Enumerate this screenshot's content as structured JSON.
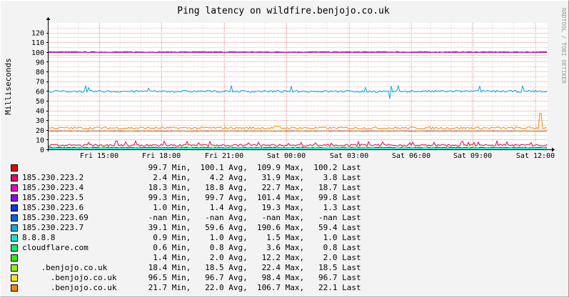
{
  "title": "Ping latency on wildfire.benjojo.co.uk",
  "watermark": "RRDTOOL / TOBI OETIKER",
  "chart_data": {
    "type": "line",
    "title": "Ping latency on wildfire.benjojo.co.uk",
    "ylabel": "Milliseconds",
    "xlabel": "",
    "ylim": [
      0,
      130
    ],
    "yticks": [
      "0",
      "10",
      "20",
      "30",
      "40",
      "50",
      "60",
      "70",
      "80",
      "90",
      "100",
      "110",
      "120"
    ],
    "xticks": [
      "Fri 15:00",
      "Fri 18:00",
      "Fri 21:00",
      "Sat 00:00",
      "Sat 03:00",
      "Sat 06:00",
      "Sat 09:00",
      "Sat 12:00"
    ],
    "grid": true,
    "series": [
      {
        "name": "",
        "color": "#ee0000",
        "min": "99.7",
        "avg": "100.1",
        "max": "109.9",
        "last": "100.2",
        "base": 100.1
      },
      {
        "name": "185.230.223.2",
        "color": "#ee0066",
        "min": "2.4",
        "avg": "4.2",
        "max": "31.9",
        "last": "3.8",
        "base": 4.2
      },
      {
        "name": "185.230.223.4",
        "color": "#ee00cc",
        "min": "18.3",
        "avg": "18.8",
        "max": "22.7",
        "last": "18.7",
        "base": 18.8
      },
      {
        "name": "185.230.223.5",
        "color": "#9900ee",
        "min": "99.3",
        "avg": "99.7",
        "max": "101.4",
        "last": "99.8",
        "base": 99.7
      },
      {
        "name": "185.230.223.6",
        "color": "#1133ee",
        "min": "1.0",
        "avg": "1.4",
        "max": "19.3",
        "last": "1.3",
        "base": 1.4
      },
      {
        "name": "185.230.223.69",
        "color": "#0066ee",
        "min": "-nan",
        "avg": "-nan",
        "max": "-nan",
        "last": "-nan",
        "base": null
      },
      {
        "name": "185.230.223.7",
        "color": "#00aaee",
        "min": "39.1",
        "avg": "59.6",
        "max": "190.6",
        "last": "59.4",
        "base": 59.6
      },
      {
        "name": "8.8.8.8",
        "color": "#00eecc",
        "min": "0.9",
        "avg": "1.0",
        "max": "1.5",
        "last": "1.0",
        "base": 1.0
      },
      {
        "name": "cloudflare.com",
        "color": "#00ee66",
        "min": "0.6",
        "avg": "0.8",
        "max": "3.6",
        "last": "0.8",
        "base": 0.8
      },
      {
        "name": "",
        "color": "#33ee00",
        "min": "1.4",
        "avg": "2.0",
        "max": "12.2",
        "last": "2.0",
        "base": 2.0
      },
      {
        "name": ".benjojo.co.uk",
        "color": "#99ee00",
        "min": "18.4",
        "avg": "18.5",
        "max": "22.4",
        "last": "18.5",
        "base": 18.5
      },
      {
        "name": ".benjojo.co.uk",
        "color": "#eeee00",
        "min": "96.5",
        "avg": "96.7",
        "max": "98.4",
        "last": "96.7",
        "base": 96.7
      },
      {
        "name": ".benjojo.co.uk",
        "color": "#ee8800",
        "min": "21.7",
        "avg": "22.0",
        "max": "106.7",
        "last": "22.1",
        "base": 22.0
      }
    ]
  },
  "legend_labels": {
    "min": "Min,",
    "avg": "Avg,",
    "max": "Max,",
    "last": "Last"
  }
}
